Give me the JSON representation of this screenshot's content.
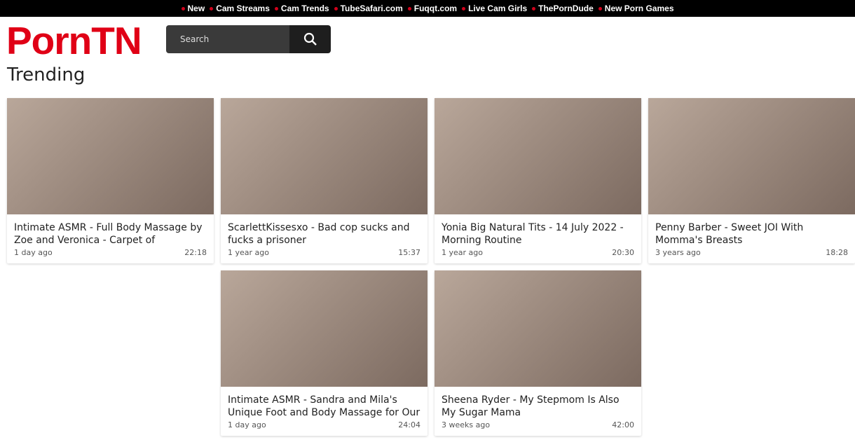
{
  "topnav": [
    "New",
    "Cam Streams",
    "Cam Trends",
    "TubeSafari.com",
    "Fuqqt.com",
    "Live Cam Girls",
    "ThePornDude",
    "New Porn Games"
  ],
  "logo": "PornTN",
  "search": {
    "placeholder": "Search"
  },
  "heading": "Trending",
  "videos": [
    {
      "title": "Intimate ASMR - Full Body Massage by Zoe and Veronica - Carpet of Tranquility",
      "age": "1 day ago",
      "duration": "22:18"
    },
    {
      "title": "ScarlettKissesxo - Bad cop sucks and fucks a prisoner",
      "age": "1 year ago",
      "duration": "15:37"
    },
    {
      "title": "Yonia Big Natural Tits - 14 July 2022 - Morning Routine",
      "age": "1 year ago",
      "duration": "20:30"
    },
    {
      "title": "Penny Barber - Sweet JOI With Momma's Breasts",
      "age": "3 years ago",
      "duration": "18:28"
    },
    {
      "title": "Intimate ASMR - Sandra and Mila's Unique Foot and Body Massage for Our",
      "age": "1 day ago",
      "duration": "24:04"
    },
    {
      "title": "Sheena Ryder - My Stepmom Is Also My Sugar Mama",
      "age": "3 weeks ago",
      "duration": "42:00"
    }
  ]
}
